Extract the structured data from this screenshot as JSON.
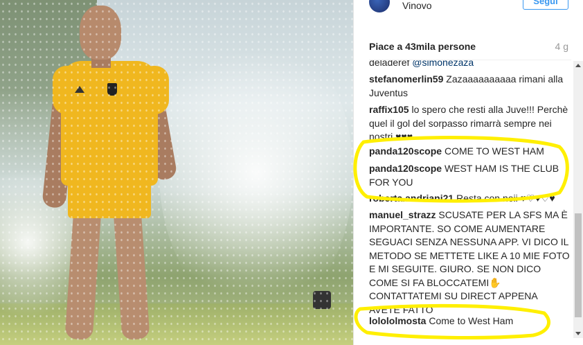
{
  "post": {
    "location": "Vinovo",
    "follow_label": "Segui",
    "likes": "Piace a 43mila persone",
    "time_ago": "4 g"
  },
  "comments": [
    {
      "user": "",
      "text": "",
      "mention": "@simonezaza",
      "partial_prefix": "deladeref"
    },
    {
      "user": "stefanomerlin59",
      "text": "Zazaaaaaaaaaa rimani alla Juventus"
    },
    {
      "user": "raffix105",
      "text": "lo spero che resti alla Juve!!! Perchè quel il gol del sorpasso rimarrà sempre nei nostri ♥♥♥"
    },
    {
      "user": "panda120scope",
      "text": "COME TO WEST HAM"
    },
    {
      "user": "panda120scope",
      "text": "WEST HAM IS THE CLUB FOR YOU"
    },
    {
      "user": "roberta.andriani21",
      "text": "Resta con noii ♥♡♥♡♥"
    },
    {
      "user": "manuel_strazz",
      "text": "SCUSATE PER LA SFS MA È IMPORTANTE. SO COME AUMENTARE SEGUACI SENZA NESSUNA APP. VI DICO IL METODO SE METTETE LIKE A 10 MIE FOTO E MI SEGUITE. GIURO. SE NON DICO COME SI FA BLOCCATEMI✋ CONTATTATEMI SU DIRECT APPENA AVETE FATTO"
    },
    {
      "user": "lolololmosta",
      "text": "Come to West Ham"
    }
  ],
  "colors": {
    "accent_blue": "#3897f0",
    "text_dark": "#262626",
    "muted": "#999999",
    "annotation_yellow": "#ffef00"
  },
  "icons": {
    "avatar": "avatar-icon",
    "scroll_up": "scroll-up-arrow-icon",
    "scroll_down": "scroll-down-arrow-icon"
  }
}
